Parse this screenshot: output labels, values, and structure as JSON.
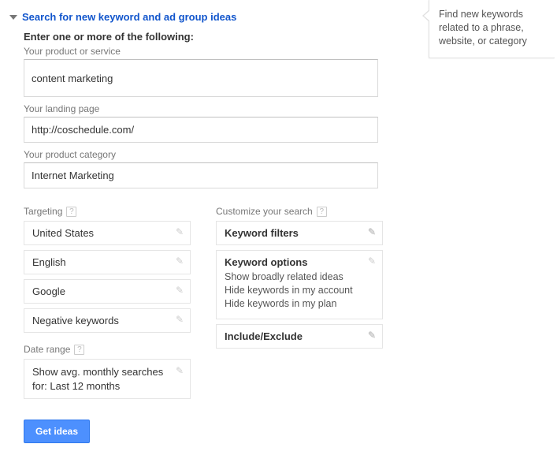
{
  "header": {
    "title": "Search for new keyword and ad group ideas"
  },
  "instruction": "Enter one or more of the following:",
  "fields": {
    "product_label": "Your product or service",
    "product_value": "content marketing",
    "landing_label": "Your landing page",
    "landing_value": "http://coschedule.com/",
    "category_label": "Your product category",
    "category_value": "Internet Marketing"
  },
  "targeting": {
    "section_label": "Targeting",
    "location": "United States",
    "language": "English",
    "network": "Google",
    "negative": "Negative keywords"
  },
  "date_range": {
    "section_label": "Date range",
    "text_line1": "Show avg. monthly searches",
    "text_line2": "for: Last 12 months"
  },
  "customize": {
    "section_label": "Customize your search",
    "filters_label": "Keyword filters",
    "options_title": "Keyword options",
    "options_line1": "Show broadly related ideas",
    "options_line2": "Hide keywords in my account",
    "options_line3": "Hide keywords in my plan",
    "include_exclude_label": "Include/Exclude"
  },
  "submit_label": "Get ideas",
  "tooltip": "Find new keywords related to a phrase, website, or category"
}
